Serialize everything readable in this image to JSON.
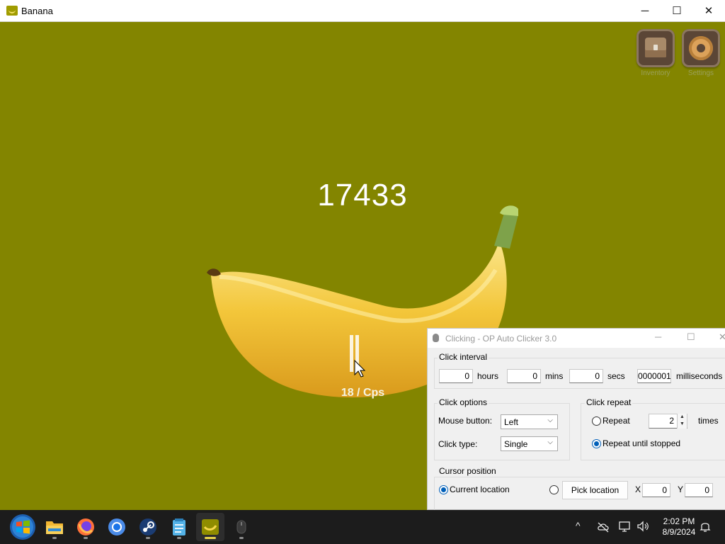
{
  "window": {
    "title": "Banana",
    "controls": {
      "minimize": "─",
      "maximize": "☐",
      "close": "✕"
    }
  },
  "game": {
    "score": "17433",
    "cps": "18 / Cps",
    "buttons": [
      {
        "label": "Inventory",
        "icon": "chest-icon"
      },
      {
        "label": "Settings",
        "icon": "gear-icon"
      }
    ],
    "colors": {
      "background": "#838500",
      "banana": "#f3c63a",
      "stem": "#7ea24a"
    }
  },
  "clicker": {
    "title": "Clicking - OP Auto Clicker 3.0",
    "controls": {
      "minimize": "─",
      "maximize": "☐",
      "close": "✕"
    },
    "interval": {
      "group_label": "Click interval",
      "hours_value": "0",
      "hours_label": "hours",
      "mins_value": "0",
      "mins_label": "mins",
      "secs_value": "0",
      "secs_label": "secs",
      "ms_value": "0000001",
      "ms_label": "milliseconds"
    },
    "options": {
      "group_label": "Click options",
      "mouse_button_label": "Mouse button:",
      "mouse_button_value": "Left",
      "click_type_label": "Click type:",
      "click_type_value": "Single"
    },
    "repeat": {
      "group_label": "Click repeat",
      "repeat_label": "Repeat",
      "repeat_value": "2",
      "times_label": "times",
      "until_stopped_label": "Repeat until stopped",
      "selected": "until_stopped"
    },
    "cursor": {
      "group_label": "Cursor position",
      "current_label": "Current location",
      "pick_label": "Pick location",
      "x_label": "X",
      "x_value": "0",
      "y_label": "Y",
      "y_value": "0",
      "selected": "current"
    }
  },
  "taskbar": {
    "apps": [
      {
        "name": "start",
        "icon": "windows-start-icon"
      },
      {
        "name": "file-explorer",
        "icon": "folder-icon"
      },
      {
        "name": "firefox",
        "icon": "firefox-icon"
      },
      {
        "name": "chrome",
        "icon": "chrome-icon"
      },
      {
        "name": "steam",
        "icon": "steam-icon"
      },
      {
        "name": "notepad",
        "icon": "notepad-icon"
      },
      {
        "name": "banana",
        "icon": "banana-app-icon",
        "active": true
      },
      {
        "name": "auto-clicker",
        "icon": "mouse-icon"
      }
    ],
    "tray": {
      "chevron": "^",
      "time": "2:02 PM",
      "date": "8/9/2024"
    }
  }
}
